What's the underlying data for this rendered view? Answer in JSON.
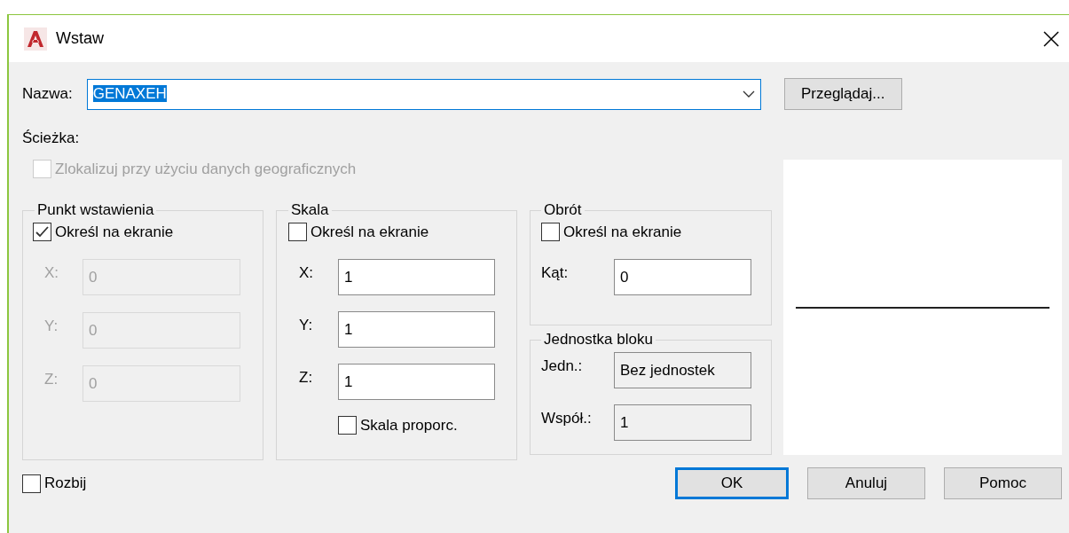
{
  "window": {
    "title": "Wstaw"
  },
  "name_row": {
    "label": "Nazwa:",
    "value": "GENAXEH",
    "value_highlighted": true,
    "browse": "Przeglądaj..."
  },
  "path_label": "Ścieżka:",
  "geo_checkbox": {
    "label": "Zlokalizuj przy użyciu danych geograficznych",
    "checked": false,
    "disabled": true
  },
  "insertion_point": {
    "title": "Punkt wstawienia",
    "specify": {
      "label": "Określ na ekranie",
      "checked": true
    },
    "fields": [
      {
        "label": "X:",
        "value": "0",
        "disabled": true
      },
      {
        "label": "Y:",
        "value": "0",
        "disabled": true
      },
      {
        "label": "Z:",
        "value": "0",
        "disabled": true
      }
    ]
  },
  "scale": {
    "title": "Skala",
    "specify": {
      "label": "Określ na ekranie",
      "checked": false
    },
    "fields": [
      {
        "label": "X:",
        "value": "1",
        "disabled": false
      },
      {
        "label": "Y:",
        "value": "1",
        "disabled": false
      },
      {
        "label": "Z:",
        "value": "1",
        "disabled": false
      }
    ],
    "uniform": {
      "label": "Skala proporc.",
      "checked": false
    }
  },
  "rotation": {
    "title": "Obrót",
    "specify": {
      "label": "Określ na ekranie",
      "checked": false
    },
    "fields": [
      {
        "label": "Kąt:",
        "value": "0",
        "disabled": false
      }
    ]
  },
  "block_unit": {
    "title": "Jednostka bloku",
    "fields": [
      {
        "label": "Jedn.:",
        "value": "Bez jednostek",
        "readonly": true
      },
      {
        "label": "Współ.:",
        "value": "1",
        "readonly": true
      }
    ]
  },
  "explode": {
    "label": "Rozbij",
    "checked": false
  },
  "buttons": [
    {
      "label": "OK",
      "default": true
    },
    {
      "label": "Anuluj",
      "default": false
    },
    {
      "label": "Pomoc",
      "default": false
    }
  ]
}
